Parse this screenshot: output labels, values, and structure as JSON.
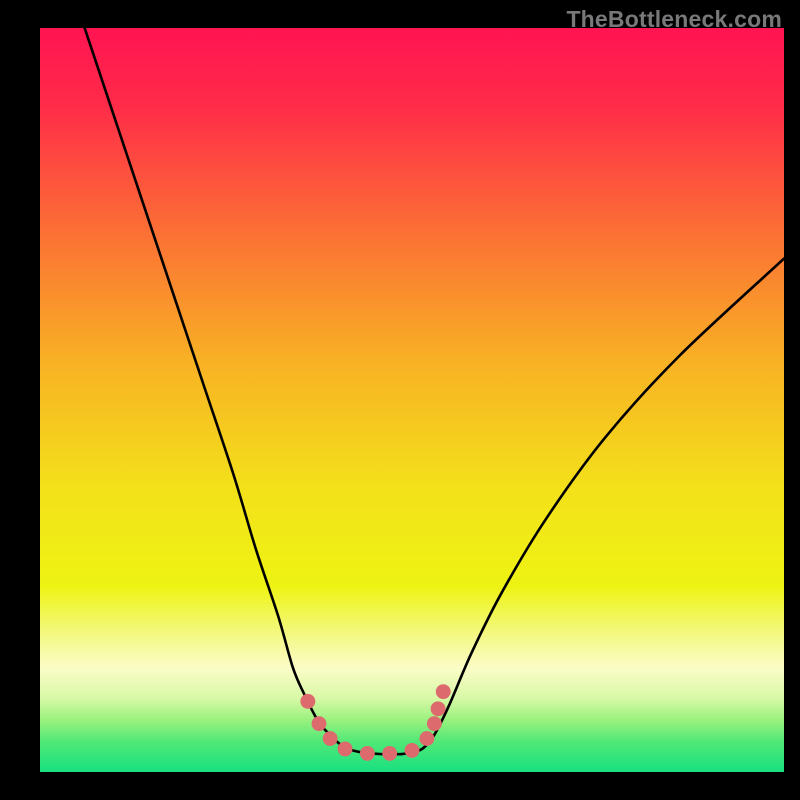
{
  "watermark": "TheBottleneck.com",
  "chart_data": {
    "type": "line",
    "title": "",
    "xlabel": "",
    "ylabel": "",
    "xlim": [
      0,
      100
    ],
    "ylim": [
      0,
      100
    ],
    "grid": false,
    "legend": false,
    "series": [
      {
        "name": "left-curve",
        "x": [
          6,
          10,
          14,
          18,
          22,
          26,
          29,
          32,
          34,
          35.5,
          37,
          38,
          39,
          40,
          41,
          42,
          43.5,
          46,
          48.5
        ],
        "y": [
          100,
          88,
          76,
          64,
          52,
          40,
          30,
          21,
          14,
          10.5,
          7.5,
          6,
          5,
          4,
          3.3,
          2.9,
          2.6,
          2.4,
          2.4
        ]
      },
      {
        "name": "right-curve",
        "x": [
          48.5,
          50,
          51.5,
          53,
          55,
          58,
          62,
          68,
          76,
          86,
          100
        ],
        "y": [
          2.4,
          2.6,
          3.2,
          5,
          9,
          16,
          24,
          34,
          45,
          56,
          69
        ]
      }
    ],
    "markers": {
      "name": "dots",
      "x": [
        36,
        37.5,
        39,
        41,
        44,
        47,
        50,
        52,
        53,
        53.5,
        54.2
      ],
      "y": [
        9.5,
        6.5,
        4.5,
        3.1,
        2.5,
        2.5,
        2.9,
        4.5,
        6.5,
        8.5,
        10.8
      ]
    },
    "gradient_stops": [
      {
        "offset": 0.0,
        "color": "#ff1452"
      },
      {
        "offset": 0.1,
        "color": "#ff2a49"
      },
      {
        "offset": 0.25,
        "color": "#fc6637"
      },
      {
        "offset": 0.45,
        "color": "#f8b224"
      },
      {
        "offset": 0.62,
        "color": "#f3e11a"
      },
      {
        "offset": 0.75,
        "color": "#eef313"
      },
      {
        "offset": 0.82,
        "color": "#f4f98b"
      },
      {
        "offset": 0.86,
        "color": "#fbfcc7"
      },
      {
        "offset": 0.9,
        "color": "#d9f9a7"
      },
      {
        "offset": 0.93,
        "color": "#9af17e"
      },
      {
        "offset": 0.96,
        "color": "#4fe877"
      },
      {
        "offset": 1.0,
        "color": "#18e080"
      }
    ],
    "marker_color": "#dd6b6e",
    "curve_color": "#000000"
  }
}
